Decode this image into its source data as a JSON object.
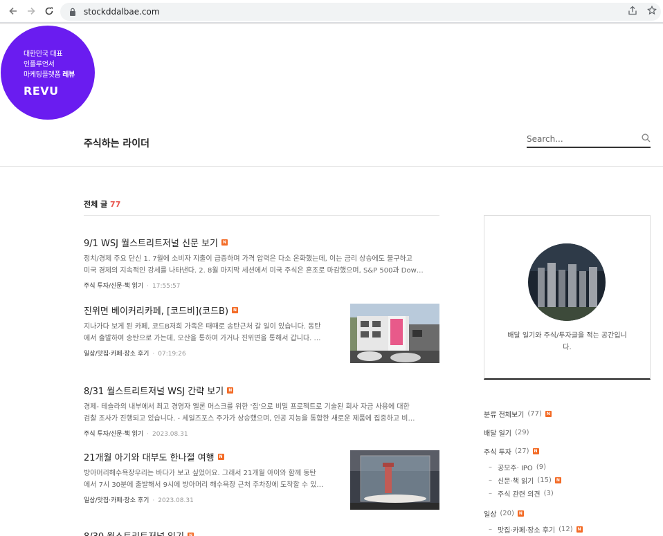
{
  "browser": {
    "url": "stockddalbae.com",
    "back_icon": "arrow-left-icon",
    "forward_icon": "arrow-right-icon",
    "reload_icon": "reload-icon"
  },
  "ad": {
    "lines": [
      "대한민국 대표",
      "인플루언서",
      "마케팅플랫폼 "
    ],
    "bold_suffix": "레뷰",
    "brand": "REVU",
    "color": "#6a1cf0"
  },
  "blog": {
    "title": "주식하는 라이더",
    "search_placeholder": "Search..."
  },
  "section": {
    "label": "전체 글",
    "count": "77",
    "count_color": "#e8554e"
  },
  "new_badge": "N",
  "posts": [
    {
      "title": "9/1 WSJ 월스트리트저널 신문 보기",
      "excerpt1": "정치/경제 주요 단신 1. 7월에 소비자 지출이 급증하며 가격 압력은 다소 온화했는데, 이는 금리 상승에도 불구하고",
      "excerpt2": "미국 경제의 지속적인 강세를 나타낸다. 2. 8월 마지막 세션에서 미국 주식은 혼조로 마감했으며, S&P 500과 Dow…",
      "category": "주식 투자/신문·책 읽기",
      "time": "17:55:57"
    },
    {
      "title": "진위면 베이커리카페, [코드비](코드B)",
      "excerpt1": "지나가다 보게 된 카페, 코드B저희 가족은 때때로 송탄근처 갈 일이 있습니다. 동탄",
      "excerpt2": "에서 출발하여 송탄으로 가는데, 오산을 통하여 가거나 진위면을 통해서 갑니다. …",
      "category": "일상/맛집·카페·장소 후기",
      "time": "07:19:26"
    },
    {
      "title": "8/31 월스트리트저널 WSJ 간략 보기",
      "excerpt1": "경제- 테슬라의 내부에서 최고 경영자 엘론 머스크를 위한 '집'으로 비밀 프로젝트로 기술된 회사 자금 사용에 대한",
      "excerpt2": "검찰 조사가 진행되고 있습니다. - 세일즈포스 주가가 상승했으며, 인공 지능을 통합한 새로운 제품에 집중하고 비…",
      "category": "주식 투자/신문·책 읽기",
      "time": "2023.08.31"
    },
    {
      "title": "21개월 아기와 대부도 한나절 여행",
      "excerpt1": "방아머리해수욕장우리는 바다가 보고 싶었어요. 그래서 21개월 아이와 함께 동탄",
      "excerpt2": "에서 7시 30분에 출발해서 9시에 방아머리 해수욕장 근처 주차장에 도착할 수 있…",
      "category": "일상/맛집·카페·장소 후기",
      "time": "2023.08.31"
    },
    {
      "title": "8/30 월스트리트저널 읽기"
    }
  ],
  "profile": {
    "desc": "배달 일기와 주식/투자글을 적는 공간입니다."
  },
  "categories": [
    {
      "label": "분류 전체보기",
      "count": "(77)",
      "new": true,
      "level": "top"
    },
    {
      "label": "배달 일기",
      "count": "(29)",
      "new": false,
      "level": "top"
    },
    {
      "label": "주식 투자",
      "count": "(27)",
      "new": true,
      "level": "top"
    },
    {
      "label": "공모주· IPO",
      "count": "(9)",
      "new": false,
      "level": "sub"
    },
    {
      "label": "신문·책 읽기",
      "count": "(15)",
      "new": true,
      "level": "sub"
    },
    {
      "label": "주식 관련 의견",
      "count": "(3)",
      "new": false,
      "level": "sub"
    },
    {
      "label": "일상",
      "count": "(20)",
      "new": true,
      "level": "top"
    },
    {
      "label": "맛집·카페·장소 후기",
      "count": "(12)",
      "new": true,
      "level": "sub"
    }
  ]
}
